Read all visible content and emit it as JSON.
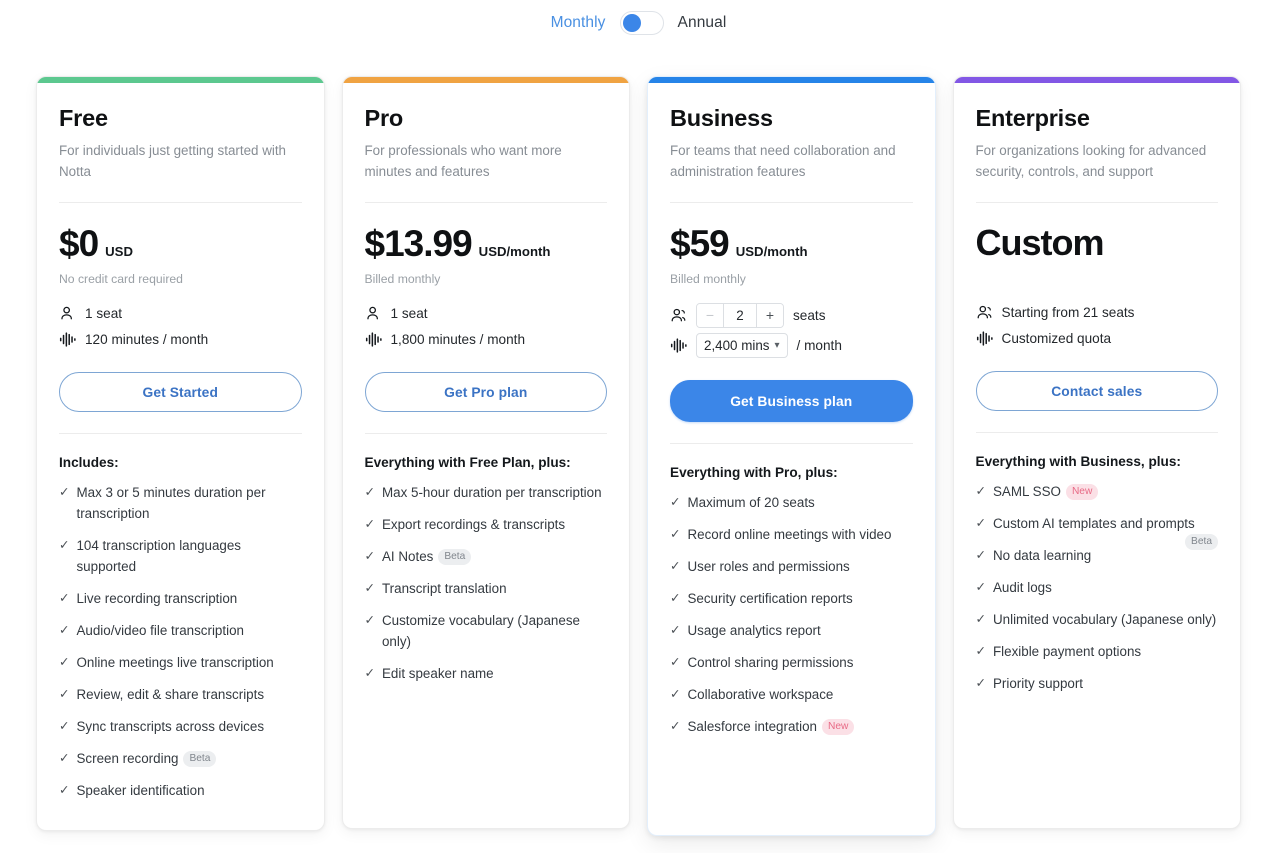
{
  "billing": {
    "monthly_label": "Monthly",
    "annual_label": "Annual",
    "selected": "Monthly",
    "accent_color": "#3b86e8"
  },
  "plans": [
    {
      "name": "Free",
      "description": "For individuals just getting started with Notta",
      "accent_color": "#5cc88f",
      "price": "$0",
      "price_unit": "USD",
      "price_note": "No credit card required",
      "seats_text": "1 seat",
      "minutes_text": "120 minutes / month",
      "cta_label": "Get Started",
      "features_title": "Includes:",
      "features": [
        {
          "text": "Max 3 or 5 minutes duration per transcription"
        },
        {
          "text": "104 transcription languages supported"
        },
        {
          "text": "Live recording transcription"
        },
        {
          "text": "Audio/video file transcription"
        },
        {
          "text": "Online meetings live transcription"
        },
        {
          "text": "Review, edit & share transcripts"
        },
        {
          "text": "Sync transcripts across devices"
        },
        {
          "text": "Screen recording",
          "badge": "Beta",
          "badge_type": "beta"
        },
        {
          "text": "Speaker identification"
        }
      ]
    },
    {
      "name": "Pro",
      "description": "For professionals who want more minutes and features",
      "accent_color": "#f0a342",
      "price": "$13.99",
      "price_unit": "USD/month",
      "price_note": "Billed monthly",
      "seats_text": "1 seat",
      "minutes_text": "1,800 minutes / month",
      "cta_label": "Get Pro plan",
      "features_title": "Everything with Free Plan, plus:",
      "features": [
        {
          "text": "Max 5-hour duration per transcription"
        },
        {
          "text": "Export recordings & transcripts"
        },
        {
          "text": "AI Notes",
          "badge": "Beta",
          "badge_type": "beta"
        },
        {
          "text": "Transcript translation"
        },
        {
          "text": "Customize vocabulary (Japanese only)"
        },
        {
          "text": "Edit speaker name"
        }
      ]
    },
    {
      "name": "Business",
      "description": "For teams that need collaboration and administration features",
      "accent_color": "#2684e8",
      "price": "$59",
      "price_unit": "USD/month",
      "price_note": "Billed monthly",
      "seats_value": "2",
      "seats_suffix": "seats",
      "minus_label": "−",
      "plus_label": "+",
      "mins_value": "2,400 mins",
      "mins_suffix": "/ month",
      "cta_label": "Get Business plan",
      "features_title": "Everything with Pro, plus:",
      "features": [
        {
          "text": "Maximum of 20 seats"
        },
        {
          "text": "Record online meetings with video"
        },
        {
          "text": "User roles and permissions"
        },
        {
          "text": "Security certification reports"
        },
        {
          "text": "Usage analytics report"
        },
        {
          "text": "Control sharing permissions"
        },
        {
          "text": "Collaborative workspace"
        },
        {
          "text": "Salesforce integration",
          "badge": "New",
          "badge_type": "new"
        }
      ]
    },
    {
      "name": "Enterprise",
      "description": "For organizations looking for advanced security, controls, and support",
      "accent_color": "#8257e5",
      "price": "Custom",
      "price_unit": "",
      "price_note": "",
      "seats_text": "Starting from 21 seats",
      "minutes_text": "Customized quota",
      "cta_label": "Contact sales",
      "features_title": "Everything with Business, plus:",
      "features": [
        {
          "text": "SAML SSO",
          "badge": "New",
          "badge_type": "new"
        },
        {
          "text": "Custom AI templates and prompts",
          "badge": "Beta",
          "badge_type": "beta",
          "badge_float": true
        },
        {
          "text": "No data learning"
        },
        {
          "text": "Audit logs"
        },
        {
          "text": "Unlimited vocabulary (Japanese only)"
        },
        {
          "text": "Flexible payment options"
        },
        {
          "text": "Priority support"
        }
      ]
    }
  ],
  "icons": {
    "seat": "person-icon",
    "minutes": "waveform-icon",
    "check": "✓",
    "caret": "⌄"
  }
}
